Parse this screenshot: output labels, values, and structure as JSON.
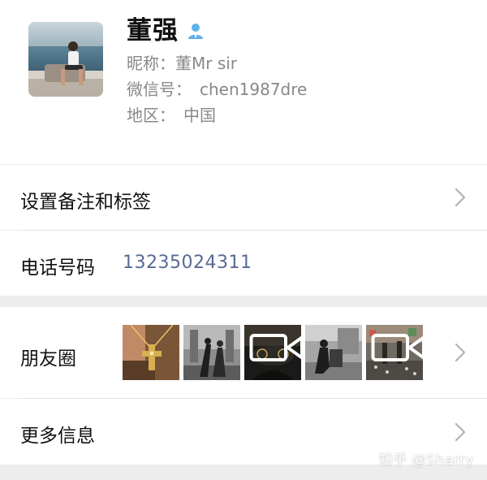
{
  "profile": {
    "name": "董强",
    "gender_icon": "user-male-icon",
    "nickname_label": "昵称：",
    "nickname": "董Mr sir",
    "wechat_id_label": "微信号：",
    "wechat_id": "chen1987dre",
    "region_label": "地区：",
    "region": "中国"
  },
  "cells": {
    "remark": {
      "label": "设置备注和标签"
    },
    "phone": {
      "label": "电话号码",
      "value": "13235024311"
    },
    "moments": {
      "label": "朋友圈",
      "thumbnails": [
        {
          "name": "moments-thumb-cross-necklace",
          "video": false
        },
        {
          "name": "moments-thumb-dancers",
          "video": false
        },
        {
          "name": "moments-thumb-car-interior",
          "video": true
        },
        {
          "name": "moments-thumb-people-sitting",
          "video": false
        },
        {
          "name": "moments-thumb-street-crowd",
          "video": true
        }
      ]
    },
    "more_info": {
      "label": "更多信息"
    }
  },
  "watermark": "知乎 @Sharry",
  "colors": {
    "background": "#ededed",
    "link_blue": "#576b95",
    "gender_blue": "#5fb0ea",
    "secondary_text": "#888888"
  }
}
